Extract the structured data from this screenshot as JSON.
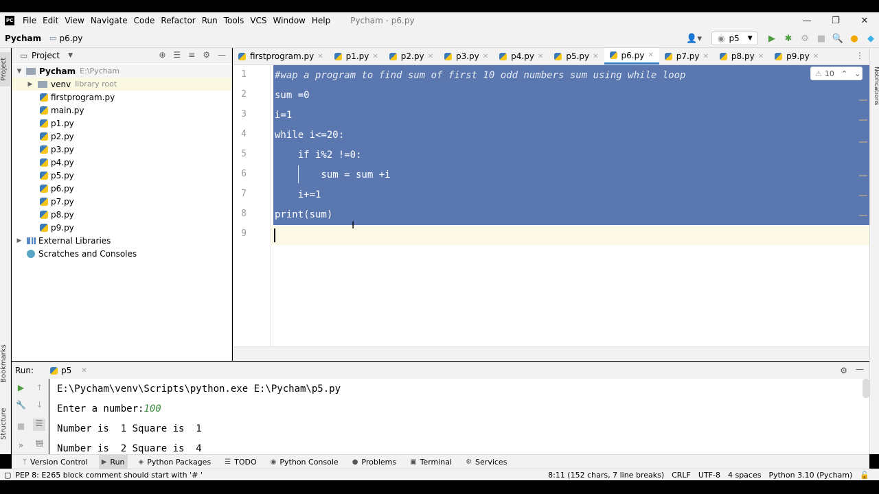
{
  "app": {
    "logo": "PC",
    "window_title": "Pycham - p6.py"
  },
  "menu": [
    "File",
    "Edit",
    "View",
    "Navigate",
    "Code",
    "Refactor",
    "Run",
    "Tools",
    "VCS",
    "Window",
    "Help"
  ],
  "window_controls": {
    "minimize": "—",
    "maximize": "❐",
    "close": "✕"
  },
  "navbar": {
    "root": "Pycham",
    "file": "p6.py",
    "run_config": "p5"
  },
  "left_stripe": {
    "project": "Project",
    "bookmarks": "Bookmarks",
    "structure": "Structure"
  },
  "project": {
    "title": "Project",
    "root": {
      "name": "Pycham",
      "path": "E:\\Pycham"
    },
    "venv": {
      "name": "venv",
      "note": "library root"
    },
    "files": [
      "firstprogram.py",
      "main.py",
      "p1.py",
      "p2.py",
      "p3.py",
      "p4.py",
      "p5.py",
      "p6.py",
      "p7.py",
      "p8.py",
      "p9.py"
    ],
    "external": "External Libraries",
    "scratches": "Scratches and Consoles"
  },
  "tabs": [
    "firstprogram.py",
    "p1.py",
    "p2.py",
    "p3.py",
    "p4.py",
    "p5.py",
    "p6.py",
    "p7.py",
    "p8.py",
    "p9.py"
  ],
  "active_tab": "p6.py",
  "editor": {
    "line_numbers": [
      "1",
      "2",
      "3",
      "4",
      "5",
      "6",
      "7",
      "8",
      "9"
    ],
    "lines": [
      "#wap a program to find sum of first 10 odd numbers sum using while loop",
      "sum =0",
      "i=1",
      "while i<=20:",
      "    if i%2 !=0:",
      "        sum = sum +i",
      "    i+=1",
      "print(sum)",
      ""
    ],
    "warnings": "10",
    "selection_color": "#5a77b0"
  },
  "notifications_label": "Notifications",
  "run": {
    "label": "Run:",
    "tab": "p5",
    "console": [
      "E:\\Pycham\\venv\\Scripts\\python.exe E:\\Pycham\\p5.py",
      "Enter a number:",
      "Number is  1 Square is  1",
      "Number is  2 Square is  4"
    ],
    "input_value": "100"
  },
  "tool_windows": [
    "Version Control",
    "Run",
    "Python Packages",
    "TODO",
    "Python Console",
    "Problems",
    "Terminal",
    "Services"
  ],
  "status": {
    "message": "PEP 8: E265 block comment should start with '# '",
    "position": "8:11 (152 chars, 7 line breaks)",
    "line_sep": "CRLF",
    "encoding": "UTF-8",
    "indent": "4 spaces",
    "interpreter": "Python 3.10 (Pycham)"
  }
}
